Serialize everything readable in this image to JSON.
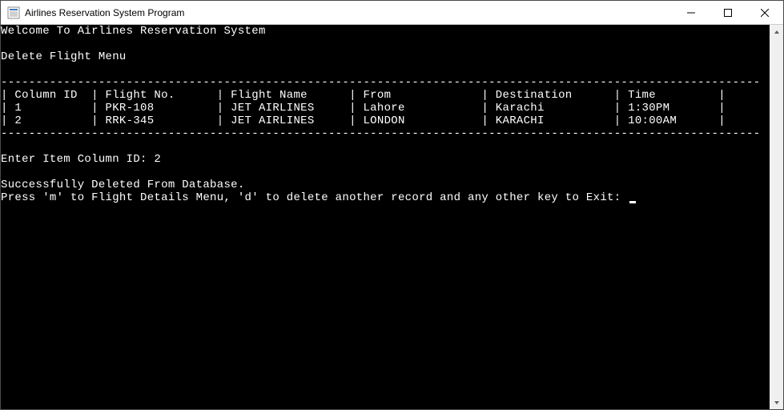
{
  "window": {
    "title": "Airlines Reservation System Program"
  },
  "console": {
    "welcome": "Welcome To Airlines Reservation System",
    "menu_title": "Delete Flight Menu",
    "divider": "-------------------------------------------------------------------------------------------------------------",
    "headers": {
      "col0": "Column ID",
      "col1": "Flight No.",
      "col2": "Flight Name",
      "col3": "From",
      "col4": "Destination",
      "col5": "Time"
    },
    "rows": [
      {
        "col0": "1",
        "col1": "PKR-108",
        "col2": "JET AIRLINES",
        "col3": "Lahore",
        "col4": "Karachi",
        "col5": "1:30PM"
      },
      {
        "col0": "2",
        "col1": "RRK-345",
        "col2": "JET AIRLINES",
        "col3": "LONDON",
        "col4": "KARACHI",
        "col5": "10:00AM"
      }
    ],
    "prompt_label": "Enter Item Column ID: ",
    "prompt_value": "2",
    "success_msg": "Successfully Deleted From Database.",
    "nav_prompt": "Press 'm' to Flight Details Menu, 'd' to delete another record and any other key to Exit: "
  }
}
